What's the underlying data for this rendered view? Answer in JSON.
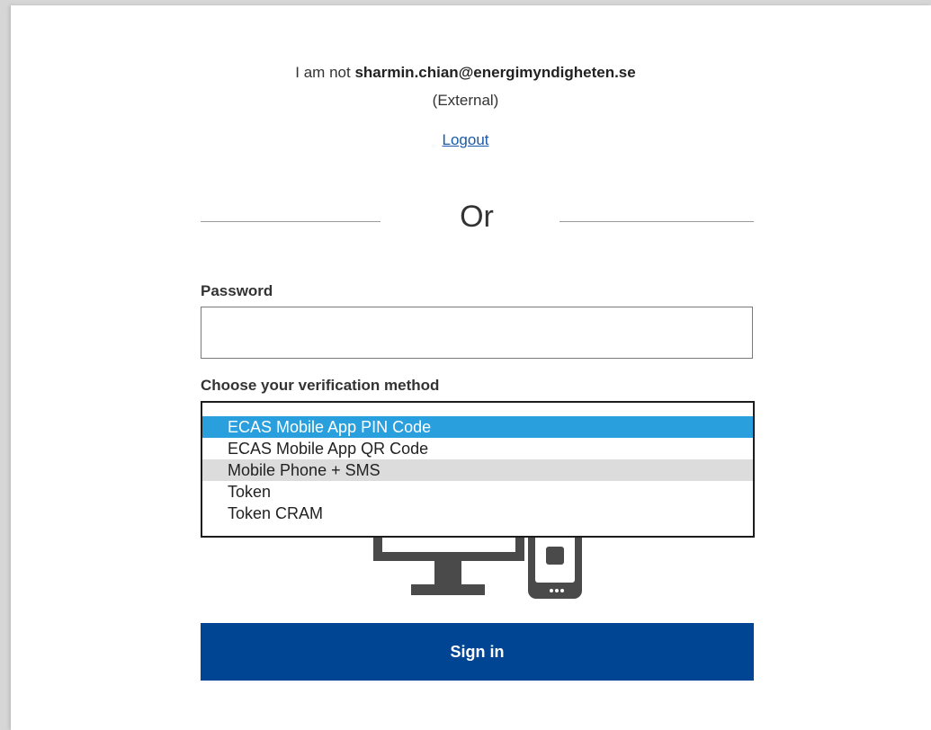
{
  "identity": {
    "prefix": "I am not",
    "email": "sharmin.chian@energimyndigheten.se",
    "type": "(External)"
  },
  "logout_label": "Logout",
  "divider_label": "Or",
  "password": {
    "label": "Password",
    "value": ""
  },
  "verification": {
    "label": "Choose your verification method",
    "options": [
      "ECAS Mobile App PIN Code",
      "ECAS Mobile App QR Code",
      "Mobile Phone + SMS",
      "Token",
      "Token CRAM"
    ],
    "selected": "ECAS Mobile App PIN Code",
    "hovered": "Mobile Phone + SMS"
  },
  "signin_label": "Sign in",
  "colors": {
    "primary_button": "#004494",
    "selected_option": "#299fdd",
    "hover_option": "#dcdcdc",
    "link": "#1a5aa8",
    "device_icon": "#4a4a4a"
  },
  "icons": [
    "desktop-monitor-icon",
    "mobile-phone-icon"
  ]
}
